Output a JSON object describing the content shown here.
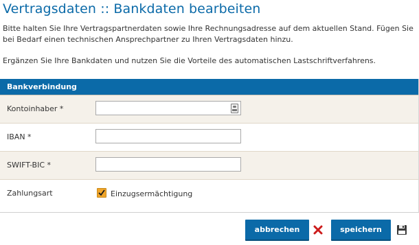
{
  "page": {
    "title": "Vertragsdaten :: Bankdaten bearbeiten",
    "intro_line1": "Bitte halten Sie Ihre Vertragspartnerdaten sowie Ihre Rechnungsadresse auf dem aktuellen Stand. Fügen Sie bei Bedarf einen technischen Ansprechpartner zu Ihren Vertragsdaten hinzu.",
    "intro_line2": "Ergänzen Sie Ihre Bankdaten und nutzen Sie die Vorteile des automatischen Lastschriftverfahrens."
  },
  "section": {
    "header": "Bankverbindung"
  },
  "fields": {
    "account_holder": {
      "label": "Kontoinhaber *",
      "value": "",
      "placeholder": ""
    },
    "iban": {
      "label": "IBAN *",
      "value": "",
      "placeholder": ""
    },
    "swift": {
      "label": "SWIFT-BIC *",
      "value": "",
      "placeholder": ""
    },
    "payment": {
      "label": "Zahlungsart",
      "option_label": "Einzugsermächtigung",
      "checked": true
    }
  },
  "actions": {
    "cancel_label": "abbrechen",
    "save_label": "speichern"
  },
  "icons": {
    "cancel": "close-icon",
    "save": "floppy-disk-icon",
    "contact": "contact-card-icon",
    "check": "checkmark-icon"
  },
  "colors": {
    "accent": "#0b6aa8",
    "row_shade": "#f5f1ea",
    "checkbox": "#f0a52a",
    "cancel_icon": "#cc1b1b"
  }
}
